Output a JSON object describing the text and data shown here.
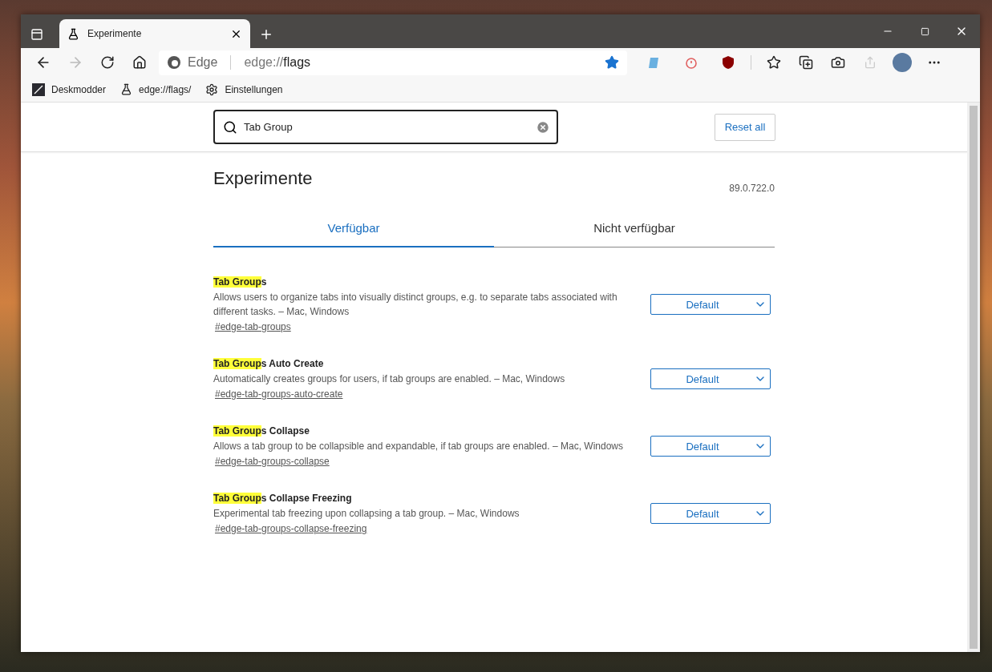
{
  "tab": {
    "title": "Experimente"
  },
  "address": {
    "site": "Edge",
    "url_prefix": "edge://",
    "url_path": "flags",
    "favorite": true
  },
  "bookmarks": [
    {
      "kind": "site",
      "label": "Deskmodder"
    },
    {
      "kind": "flask",
      "label": "edge://flags/"
    },
    {
      "kind": "gear",
      "label": "Einstellungen"
    }
  ],
  "search": {
    "value": "Tab Group"
  },
  "reset_button": "Reset all",
  "heading": "Experimente",
  "version": "89.0.722.0",
  "tabs": [
    {
      "label": "Verfügbar",
      "selected": true
    },
    {
      "label": "Nicht verfügbar",
      "selected": false
    }
  ],
  "flags": [
    {
      "match": "Tab Group",
      "rest": "s",
      "description": "Allows users to organize tabs into visually distinct groups, e.g. to separate tabs associated with different tasks. – Mac, Windows",
      "link": "#edge-tab-groups",
      "value": "Default"
    },
    {
      "match": "Tab Group",
      "rest": "s Auto Create",
      "description": "Automatically creates groups for users, if tab groups are enabled. – Mac, Windows",
      "link": "#edge-tab-groups-auto-create",
      "value": "Default"
    },
    {
      "match": "Tab Group",
      "rest": "s Collapse",
      "description": "Allows a tab group to be collapsible and expandable, if tab groups are enabled. – Mac, Windows",
      "link": "#edge-tab-groups-collapse",
      "value": "Default"
    },
    {
      "match": "Tab Group",
      "rest": "s Collapse Freezing",
      "description": "Experimental tab freezing upon collapsing a tab group. – Mac, Windows",
      "link": "#edge-tab-groups-collapse-freezing",
      "value": "Default"
    }
  ]
}
